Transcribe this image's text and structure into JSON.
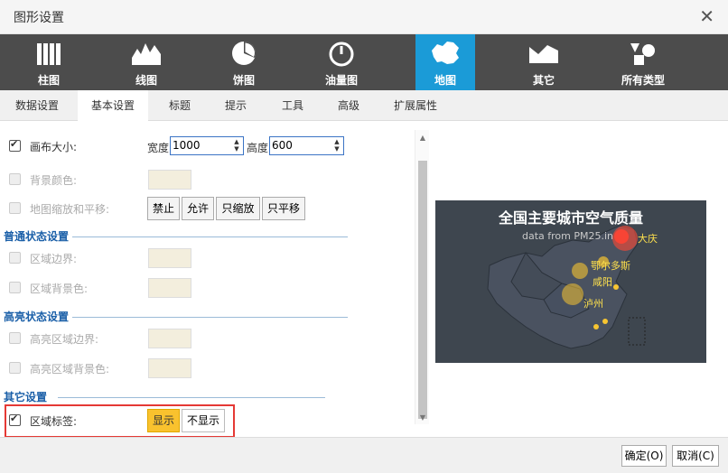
{
  "window": {
    "title": "图形设置",
    "close_glyph": "✕"
  },
  "chart_types": [
    {
      "label": "柱图",
      "icon": "bar-chart-icon",
      "active": false
    },
    {
      "label": "线图",
      "icon": "line-chart-icon",
      "active": false
    },
    {
      "label": "饼图",
      "icon": "pie-chart-icon",
      "active": false
    },
    {
      "label": "油量图",
      "icon": "gauge-icon",
      "active": false
    },
    {
      "label": "地图",
      "icon": "china-map-icon",
      "active": true
    },
    {
      "label": "其它",
      "icon": "other-chart-icon",
      "active": false
    },
    {
      "label": "所有类型",
      "icon": "all-types-icon",
      "active": false
    }
  ],
  "tabs": [
    {
      "label": "数据设置",
      "active": false
    },
    {
      "label": "基本设置",
      "active": true
    },
    {
      "label": "标题",
      "active": false
    },
    {
      "label": "提示",
      "active": false
    },
    {
      "label": "工具",
      "active": false
    },
    {
      "label": "高级",
      "active": false
    },
    {
      "label": "扩展属性",
      "active": false
    }
  ],
  "settings": {
    "canvas_size": {
      "label": "画布大小:",
      "checked": true,
      "width_label": "宽度",
      "width_value": "1000",
      "height_label": "高度",
      "height_value": "600"
    },
    "bg_color": {
      "label": "背景颜色:",
      "checked": false
    },
    "map_zoom": {
      "label": "地图缩放和平移:",
      "checked": false,
      "buttons": [
        "禁止",
        "允许",
        "只缩放",
        "只平移"
      ]
    },
    "normal_section": "普通状态设置",
    "region_border": {
      "label": "区域边界:",
      "checked": false
    },
    "region_bg": {
      "label": "区域背景色:",
      "checked": false
    },
    "highlight_section": "高亮状态设置",
    "hl_border": {
      "label": "高亮区域边界:",
      "checked": false
    },
    "hl_bg": {
      "label": "高亮区域背景色:",
      "checked": false
    },
    "other_section": "其它设置",
    "region_label": {
      "label": "区域标签:",
      "checked": true,
      "show": "显示",
      "hide": "不显示",
      "selected": "显示"
    }
  },
  "preview": {
    "title": "全国主要城市空气质量",
    "subtitle": "data from PM25.in",
    "cities": [
      "大庆",
      "鄂尔多斯",
      "咸阳",
      "泸州"
    ]
  },
  "footer": {
    "ok": "确定(O)",
    "cancel": "取消(C)"
  },
  "colors": {
    "active_tab": "#1b9bd7",
    "toolbar": "#4c4c4c",
    "section": "#1a5fa8",
    "highlight_border": "#e53935",
    "show_button": "#f9c22e"
  }
}
